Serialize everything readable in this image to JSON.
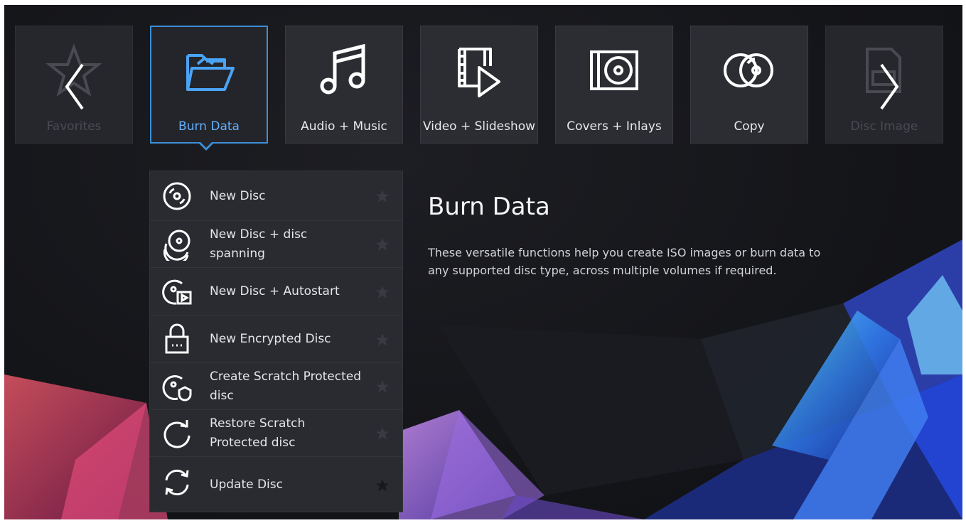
{
  "window": {
    "title": "Burn Data"
  },
  "categories": [
    {
      "label": "Favorites",
      "icon": "star-icon",
      "state": "faded"
    },
    {
      "label": "Burn Data",
      "icon": "open-folder-icon",
      "state": "active"
    },
    {
      "label": "Audio + Music",
      "icon": "music-note-icon",
      "state": "normal"
    },
    {
      "label": "Video + Slideshow",
      "icon": "film-play-icon",
      "state": "normal"
    },
    {
      "label": "Covers + Inlays",
      "icon": "disc-cover-icon",
      "state": "normal"
    },
    {
      "label": "Copy",
      "icon": "two-discs-icon",
      "state": "normal"
    },
    {
      "label": "Disc Image",
      "icon": "disc-image-icon",
      "state": "faded"
    }
  ],
  "nav": {
    "prev": "chevron-left-icon",
    "next": "chevron-right-icon"
  },
  "menu": {
    "items": [
      {
        "label": "New Disc",
        "icon": "disc-icon",
        "favorited": false
      },
      {
        "label": "New Disc + disc spanning",
        "icon": "stacked-discs-icon",
        "favorited": false
      },
      {
        "label": "New Disc + Autostart",
        "icon": "disc-autostart-icon",
        "favorited": false
      },
      {
        "label": "New Encrypted Disc",
        "icon": "padlock-icon",
        "favorited": false
      },
      {
        "label": "Create Scratch Protected disc",
        "icon": "disc-shield-icon",
        "favorited": false
      },
      {
        "label": "Restore Scratch Protected disc",
        "icon": "refresh-arrow-icon",
        "favorited": false
      },
      {
        "label": "Update Disc",
        "icon": "sync-arrows-icon",
        "favorited": true
      }
    ]
  },
  "info": {
    "title": "Burn Data",
    "description": "These versatile functions help you create ISO images or burn data to any supported disc type, across multiple volumes if required."
  },
  "colors": {
    "accent": "#3d8fd8",
    "active_label": "#62b0ff",
    "tile_bg": "#2c2d33",
    "menu_bg": "#2a2b31"
  }
}
